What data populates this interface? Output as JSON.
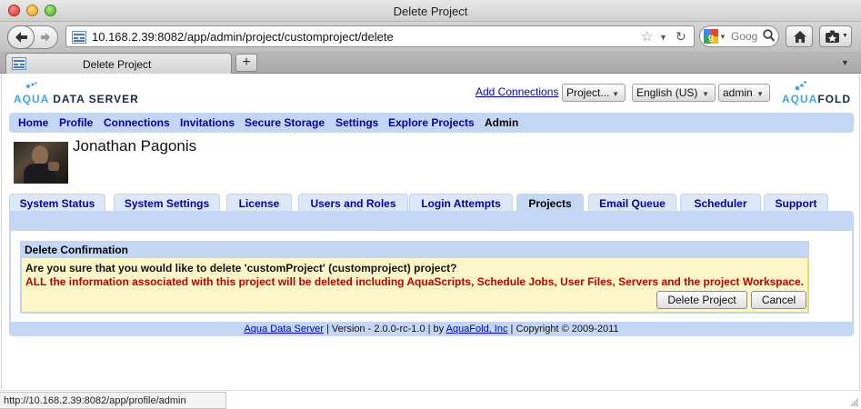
{
  "window": {
    "title": "Delete Project"
  },
  "browser": {
    "url": "10.168.2.39:8082/app/admin/project/customproject/delete",
    "search_placeholder": "Goog",
    "tab_label": "Delete Project",
    "new_tab_label": "+",
    "status_url": "http://10.168.2.39:8082/app/profile/admin"
  },
  "header": {
    "logo_left_top": "AQUA",
    "logo_left_aqua": "AQUA",
    "logo_left_rest": " DATA SERVER",
    "add_connections": "Add Connections",
    "project_select": "Project...",
    "language_select": "English (US)",
    "user_select": "admin",
    "logo_right_aqua": "AQUA",
    "logo_right_fold": "FOLD"
  },
  "nav": {
    "home": "Home",
    "profile": "Profile",
    "connections": "Connections",
    "invitations": "Invitations",
    "secure_storage": "Secure Storage",
    "settings": "Settings",
    "explore_projects": "Explore Projects",
    "admin": "Admin"
  },
  "user": {
    "name": "Jonathan Pagonis"
  },
  "tabs": {
    "system_status": "System Status",
    "system_settings": "System Settings",
    "license": "License",
    "users_roles": "Users and Roles",
    "login_attempts": "Login Attempts",
    "projects": "Projects",
    "email_queue": "Email Queue",
    "scheduler": "Scheduler",
    "support": "Support"
  },
  "confirm": {
    "heading": "Delete Confirmation",
    "question": "Are you sure that you would like to delete 'customProject' (customproject) project?",
    "warning": "ALL the information associated with this project will be deleted including AquaScripts, Schedule Jobs, User Files, Servers and the project Workspace.",
    "delete_label": "Delete Project",
    "cancel_label": "Cancel"
  },
  "footer": {
    "product_link": "Aqua Data Server",
    "version": " | Version - 2.0.0-rc-1.0 | by ",
    "company_link": "AquaFold, Inc",
    "copyright": " | Copyright © 2009-2011"
  },
  "colors": {
    "nav_bg": "#c3d7f5",
    "link": "#0000b4",
    "warning": "#c00000",
    "confirm_bg": "#fdf7c8",
    "brand_aqua": "#3da6e3"
  }
}
